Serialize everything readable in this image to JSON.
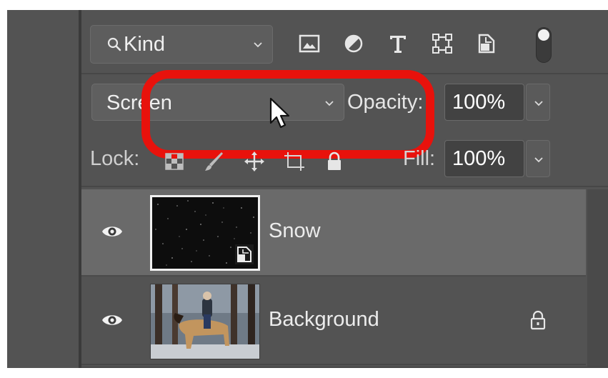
{
  "filter": {
    "kind_label": "Kind",
    "icons": [
      "image-filter-icon",
      "adjustment-filter-icon",
      "type-filter-icon",
      "shape-filter-icon",
      "smart-object-filter-icon"
    ],
    "toggle_on": true
  },
  "blend": {
    "mode_label": "Screen",
    "opacity_label": "Opacity:",
    "opacity_value": "100%"
  },
  "lock": {
    "label": "Lock:",
    "icons": [
      "lock-transparent-pixels-icon",
      "lock-image-pixels-icon",
      "lock-position-icon",
      "lock-artboard-icon",
      "lock-all-icon"
    ],
    "fill_label": "Fill:",
    "fill_value": "100%"
  },
  "layers": [
    {
      "name": "Snow",
      "visible": true,
      "selected": true,
      "smart_object": true
    },
    {
      "name": "Background",
      "visible": true,
      "selected": false,
      "locked": true
    }
  ],
  "colors": {
    "panel": "#535353",
    "selected_row": "#6a6a6a",
    "highlight": "#e8120c"
  }
}
